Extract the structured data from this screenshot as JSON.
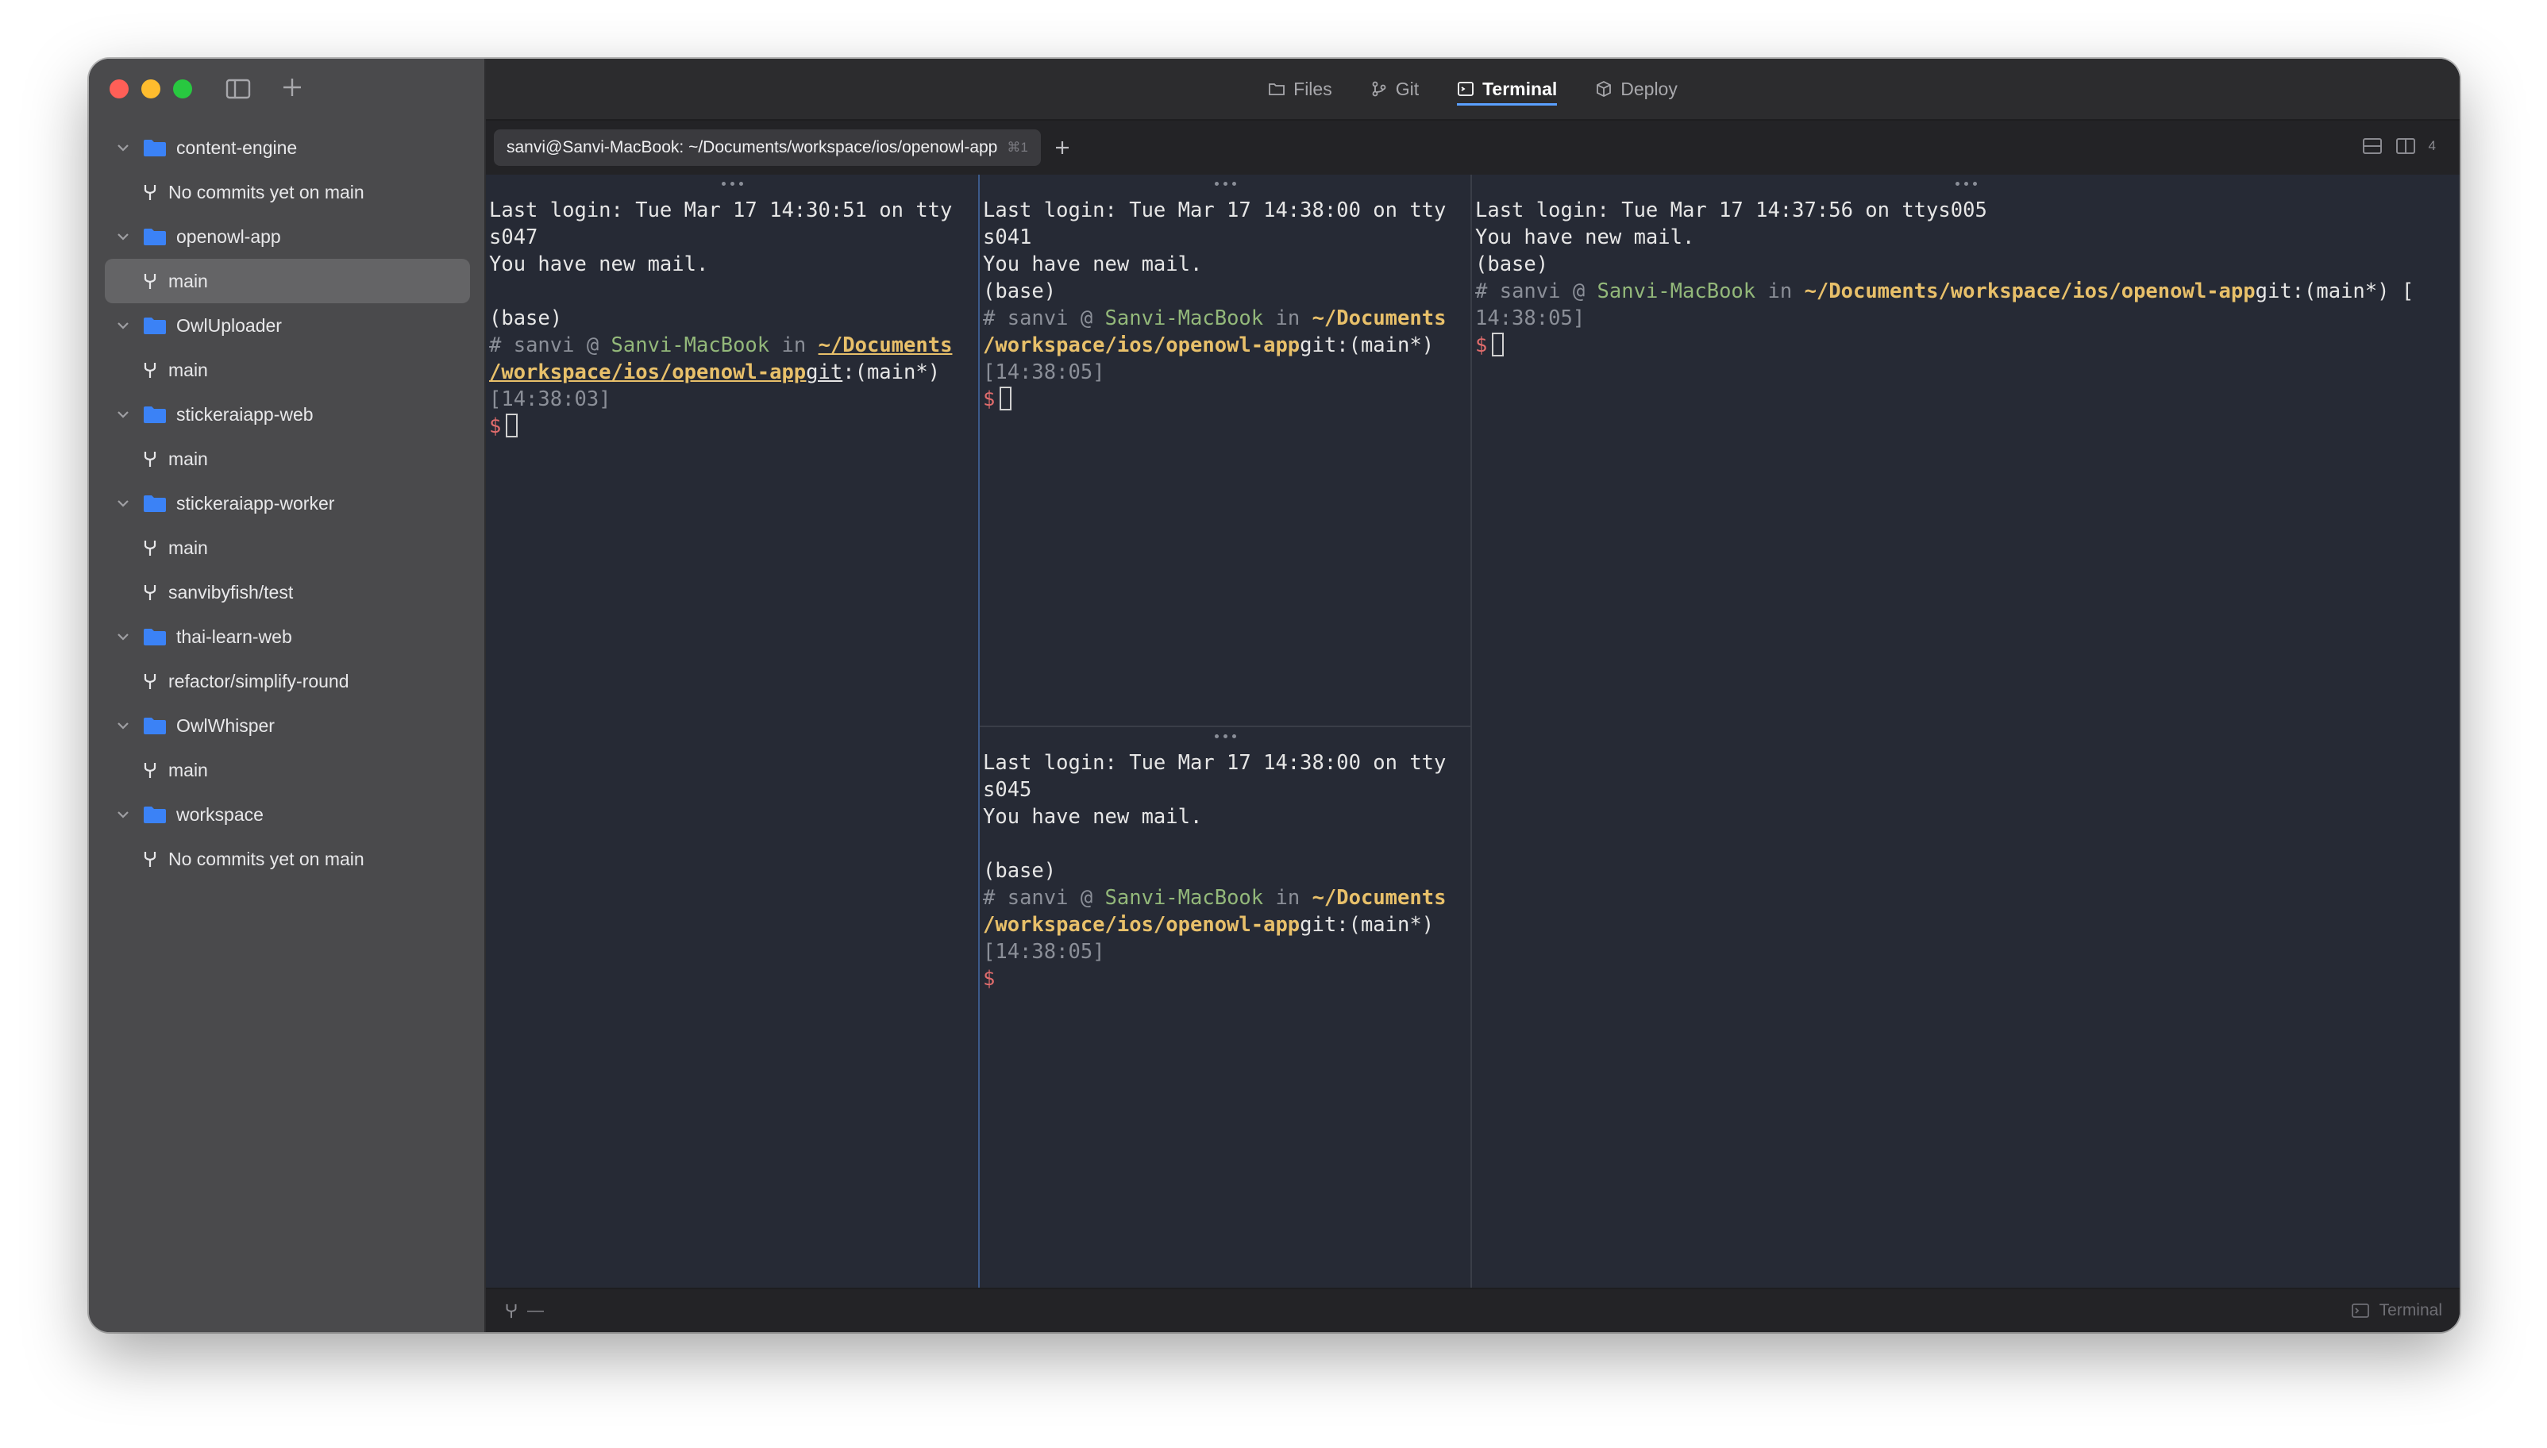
{
  "sidebar": {
    "projects": [
      {
        "name": "content-engine",
        "branches": [
          "No commits yet on main"
        ]
      },
      {
        "name": "openowl-app",
        "branches": [
          "main"
        ]
      },
      {
        "name": "OwlUploader",
        "branches": [
          "main"
        ]
      },
      {
        "name": "stickeraiapp-web",
        "branches": [
          "main"
        ]
      },
      {
        "name": "stickeraiapp-worker",
        "branches": [
          "main",
          "sanvibyfish/test"
        ]
      },
      {
        "name": "thai-learn-web",
        "branches": [
          "refactor/simplify-round"
        ]
      },
      {
        "name": "OwlWhisper",
        "branches": [
          "main"
        ]
      },
      {
        "name": "workspace",
        "branches": [
          "No commits yet on main"
        ]
      }
    ],
    "selected": "openowl-app/main"
  },
  "nav": {
    "files": "Files",
    "git": "Git",
    "terminal": "Terminal",
    "deploy": "Deploy",
    "active": "Terminal"
  },
  "terminal_tab": {
    "title": "sanvi@Sanvi-MacBook: ~/Documents/workspace/ios/openowl-app",
    "shortcut": "⌘1"
  },
  "split_count": "4",
  "panes": [
    {
      "login": "Last login: Tue Mar 17 14:30:51 on tty",
      "login2": "s047",
      "mail": "You have new mail.",
      "base": "(base)",
      "user": "sanvi",
      "host": "Sanvi-MacBook",
      "path1": "~/Documents",
      "path2": "/workspace/ios/openowl-app",
      "git": "git",
      "branch": ":(main*)",
      "time": "[14:38:03]",
      "prompt": "$"
    },
    {
      "login": "Last login: Tue Mar 17 14:38:00 on tty",
      "login2": "s041",
      "mail": "You have new mail.",
      "base": "(base)",
      "user": "sanvi",
      "host": "Sanvi-MacBook",
      "path1": "~/Documents",
      "path2": "/workspace/ios/openowl-app",
      "git": "git",
      "branch": ":(main*)",
      "time": "[14:38:05]",
      "prompt": "$"
    },
    {
      "login": "Last login: Tue Mar 17 14:37:56 on ttys005",
      "mail": "You have new mail.",
      "base": "(base)",
      "user": "sanvi",
      "host": "Sanvi-MacBook",
      "path": "~/Documents/workspace/ios/openowl-app",
      "git": "git",
      "branch": ":(main*) [",
      "time": "14:38:05]",
      "prompt": "$"
    },
    {
      "login": "Last login: Tue Mar 17 14:38:00 on tty",
      "login2": "s045",
      "mail": "You have new mail.",
      "base": "(base)",
      "user": "sanvi",
      "host": "Sanvi-MacBook",
      "path1": "~/Documents",
      "path2": "/workspace/ios/openowl-app",
      "git": "git",
      "branch": ":(main*)",
      "time": "[14:38:05]",
      "prompt": "$"
    }
  ],
  "statusbar": {
    "branch": "—",
    "right_label": "Terminal"
  }
}
